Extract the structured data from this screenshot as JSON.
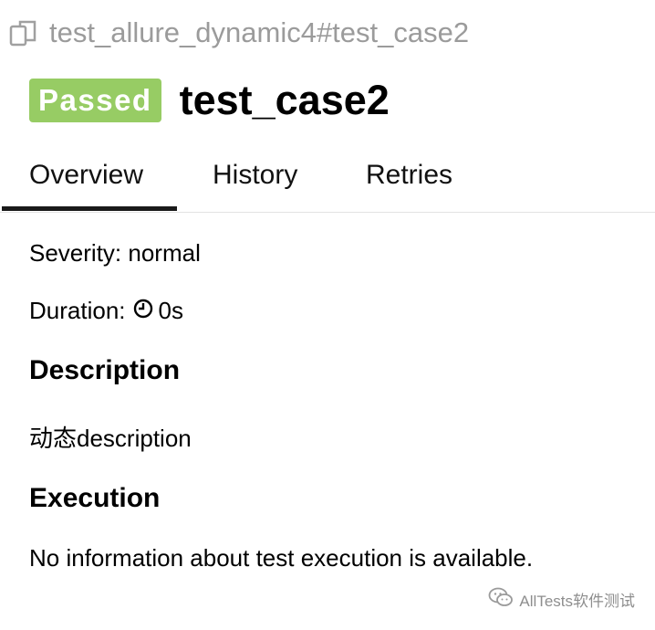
{
  "header": {
    "breadcrumb": "test_allure_dynamic4#test_case2",
    "status_badge": "Passed",
    "title": "test_case2"
  },
  "tabs": [
    {
      "label": "Overview",
      "active": true
    },
    {
      "label": "History",
      "active": false
    },
    {
      "label": "Retries",
      "active": false
    }
  ],
  "overview": {
    "severity_label": "Severity:",
    "severity_value": "normal",
    "duration_label": "Duration:",
    "duration_value": "0s",
    "description_heading": "Description",
    "description_text": "动态description",
    "execution_heading": "Execution",
    "execution_text": "No information about test execution is available."
  },
  "watermark": {
    "text": "AllTests软件测试"
  },
  "colors": {
    "passed": "#97cc64",
    "muted_text": "#9b9b9b",
    "active_tab_underline": "#1a1a1a"
  },
  "icons": {
    "breadcrumb": "copy-icon",
    "duration": "clock-icon",
    "watermark": "wechat-icon"
  }
}
